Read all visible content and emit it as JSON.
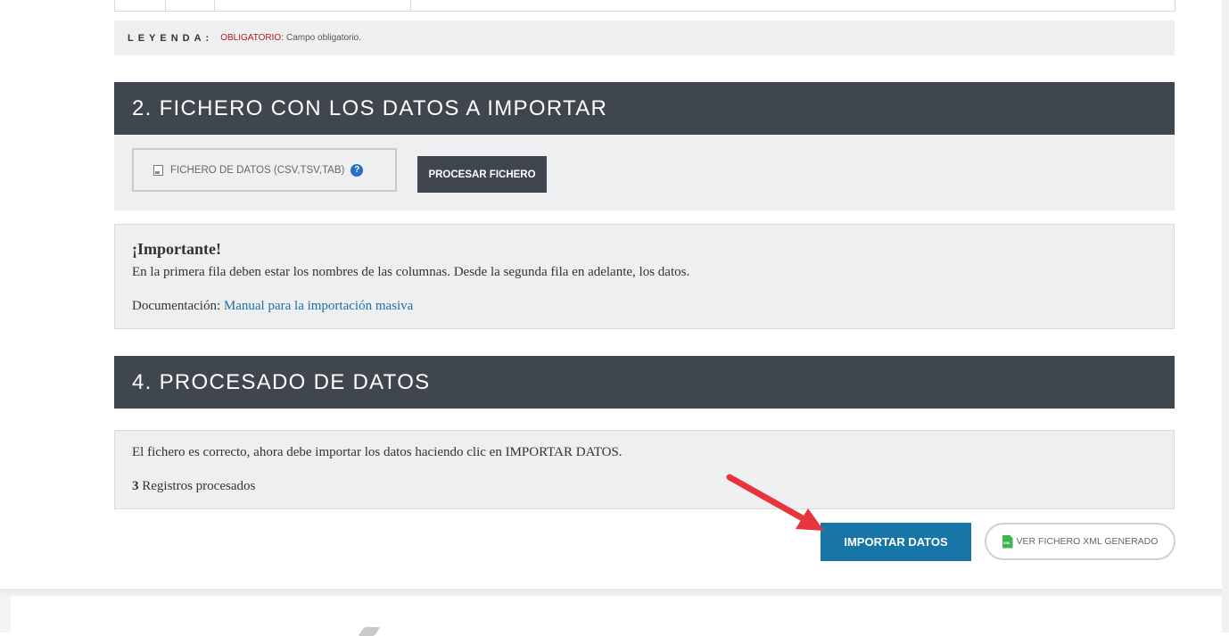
{
  "table_remnant": {
    "tail_text": ""
  },
  "legend": {
    "label": "LEYENDA:",
    "key": "OBLIGATORIO:",
    "description": "Campo obligatorio."
  },
  "section_file": {
    "title": "2. FICHERO CON LOS DATOS A IMPORTAR",
    "file_input_label": "FICHERO DE DATOS (CSV,TSV,TAB)",
    "help_icon": "?",
    "process_button": "PROCESAR FICHERO"
  },
  "important": {
    "title": "¡Importante!",
    "text": "En la primera fila deben estar los nombres de las columnas. Desde la segunda fila en adelante, los datos.",
    "doc_prefix": "Documentación:",
    "doc_link": "Manual para la importación masiva"
  },
  "section_process": {
    "title": "4. PROCESADO DE DATOS",
    "message": "El fichero es correcto, ahora debe importar los datos haciendo clic en IMPORTAR DATOS.",
    "count": "3",
    "count_label": "Registros procesados"
  },
  "actions": {
    "import_button": "IMPORTAR DATOS",
    "xml_button": "VER FICHERO XML GENERADO",
    "xml_icon_text": "XML"
  },
  "colors": {
    "header_bg": "#40464d",
    "primary": "#1875a8",
    "link": "#1f6ea8",
    "required": "#b01e1e",
    "annotation_arrow": "#e8353b"
  },
  "icons": [
    "file-image-icon",
    "help-icon",
    "xml-file-icon",
    "annotation-arrow"
  ]
}
